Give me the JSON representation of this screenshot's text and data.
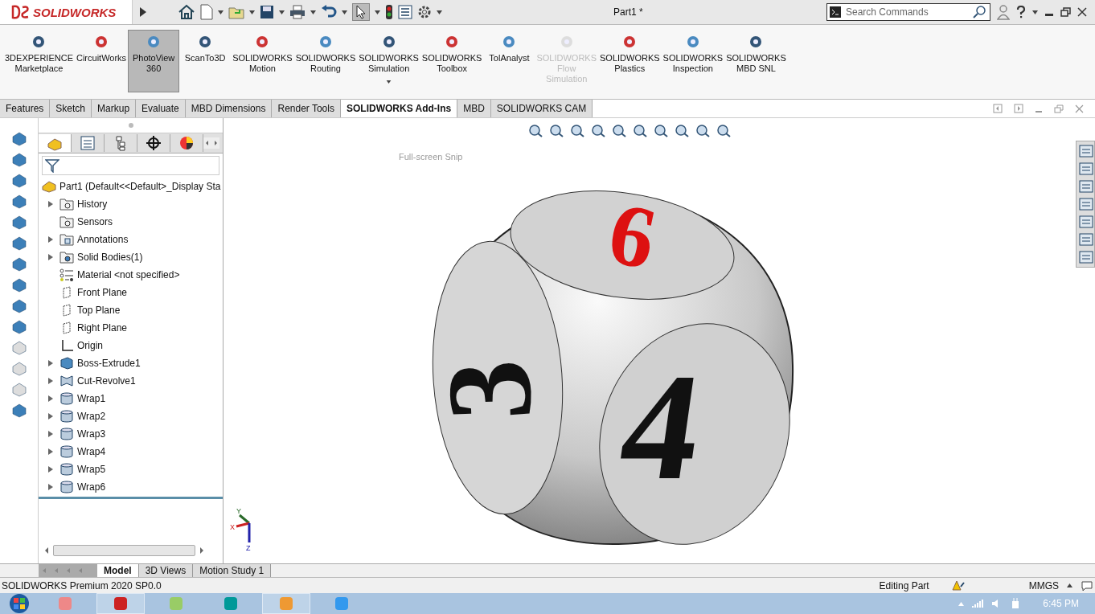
{
  "app": {
    "logo": "SOLIDWORKS",
    "title": "Part1 *",
    "search": {
      "placeholder": "Search Commands"
    }
  },
  "commands": [
    {
      "lines": [
        "3DEXPERIENCE",
        "Marketplace"
      ],
      "selected": false,
      "disabled": false,
      "dropdown": false
    },
    {
      "lines": [
        "CircuitWorks"
      ],
      "selected": false,
      "disabled": false,
      "dropdown": false
    },
    {
      "lines": [
        "PhotoView",
        "360"
      ],
      "selected": true,
      "disabled": false,
      "dropdown": false
    },
    {
      "lines": [
        "ScanTo3D"
      ],
      "selected": false,
      "disabled": false,
      "dropdown": false
    },
    {
      "lines": [
        "SOLIDWORKS",
        "Motion"
      ],
      "selected": false,
      "disabled": false,
      "dropdown": false
    },
    {
      "lines": [
        "SOLIDWORKS",
        "Routing"
      ],
      "selected": false,
      "disabled": false,
      "dropdown": false
    },
    {
      "lines": [
        "SOLIDWORKS",
        "Simulation"
      ],
      "selected": false,
      "disabled": false,
      "dropdown": true
    },
    {
      "lines": [
        "SOLIDWORKS",
        "Toolbox"
      ],
      "selected": false,
      "disabled": false,
      "dropdown": false
    },
    {
      "lines": [
        "TolAnalyst"
      ],
      "selected": false,
      "disabled": false,
      "dropdown": false
    },
    {
      "lines": [
        "SOLIDWORKS",
        "Flow",
        "Simulation"
      ],
      "selected": false,
      "disabled": true,
      "dropdown": false
    },
    {
      "lines": [
        "SOLIDWORKS",
        "Plastics"
      ],
      "selected": false,
      "disabled": false,
      "dropdown": false
    },
    {
      "lines": [
        "SOLIDWORKS",
        "Inspection"
      ],
      "selected": false,
      "disabled": false,
      "dropdown": false
    },
    {
      "lines": [
        "SOLIDWORKS",
        "MBD SNL"
      ],
      "selected": false,
      "disabled": false,
      "dropdown": false
    }
  ],
  "tabs": [
    {
      "label": "Features",
      "selected": false
    },
    {
      "label": "Sketch",
      "selected": false
    },
    {
      "label": "Markup",
      "selected": false
    },
    {
      "label": "Evaluate",
      "selected": false
    },
    {
      "label": "MBD Dimensions",
      "selected": false
    },
    {
      "label": "Render Tools",
      "selected": false
    },
    {
      "label": "SOLIDWORKS Add-Ins",
      "selected": true
    },
    {
      "label": "MBD",
      "selected": false
    },
    {
      "label": "SOLIDWORKS CAM",
      "selected": false
    }
  ],
  "tree": {
    "root": "Part1  (Default<<Default>_Display Sta",
    "items": [
      {
        "label": "History",
        "kind": "history",
        "expandable": true
      },
      {
        "label": "Sensors",
        "kind": "sensor",
        "expandable": false
      },
      {
        "label": "Annotations",
        "kind": "annotation",
        "expandable": true
      },
      {
        "label": "Solid Bodies(1)",
        "kind": "bodies",
        "expandable": true
      },
      {
        "label": "Material <not specified>",
        "kind": "material",
        "expandable": false
      },
      {
        "label": "Front Plane",
        "kind": "plane",
        "expandable": false
      },
      {
        "label": "Top Plane",
        "kind": "plane",
        "expandable": false
      },
      {
        "label": "Right Plane",
        "kind": "plane",
        "expandable": false
      },
      {
        "label": "Origin",
        "kind": "origin",
        "expandable": false
      },
      {
        "label": "Boss-Extrude1",
        "kind": "extrude",
        "expandable": true
      },
      {
        "label": "Cut-Revolve1",
        "kind": "revolve",
        "expandable": true
      },
      {
        "label": "Wrap1",
        "kind": "wrap",
        "expandable": true
      },
      {
        "label": "Wrap2",
        "kind": "wrap",
        "expandable": true
      },
      {
        "label": "Wrap3",
        "kind": "wrap",
        "expandable": true
      },
      {
        "label": "Wrap4",
        "kind": "wrap",
        "expandable": true
      },
      {
        "label": "Wrap5",
        "kind": "wrap",
        "expandable": true
      },
      {
        "label": "Wrap6",
        "kind": "wrap",
        "expandable": true
      }
    ]
  },
  "viewport": {
    "snip_hint": "Full-screen Snip",
    "die_faces": [
      {
        "label": "6",
        "color": "#dd1111"
      },
      {
        "label": "3",
        "color": "#111111"
      },
      {
        "label": "4",
        "color": "#111111"
      }
    ],
    "triad": {
      "x": "X",
      "y": "Y",
      "z": "Z"
    }
  },
  "bottom_tabs": [
    {
      "label": "Model",
      "selected": true
    },
    {
      "label": "3D Views",
      "selected": false
    },
    {
      "label": "Motion Study 1",
      "selected": false
    }
  ],
  "status_bar": {
    "product": "SOLIDWORKS Premium 2020 SP0.0",
    "mode": "Editing Part",
    "units": "MMGS"
  },
  "taskbar": {
    "time": "6:45 PM"
  }
}
